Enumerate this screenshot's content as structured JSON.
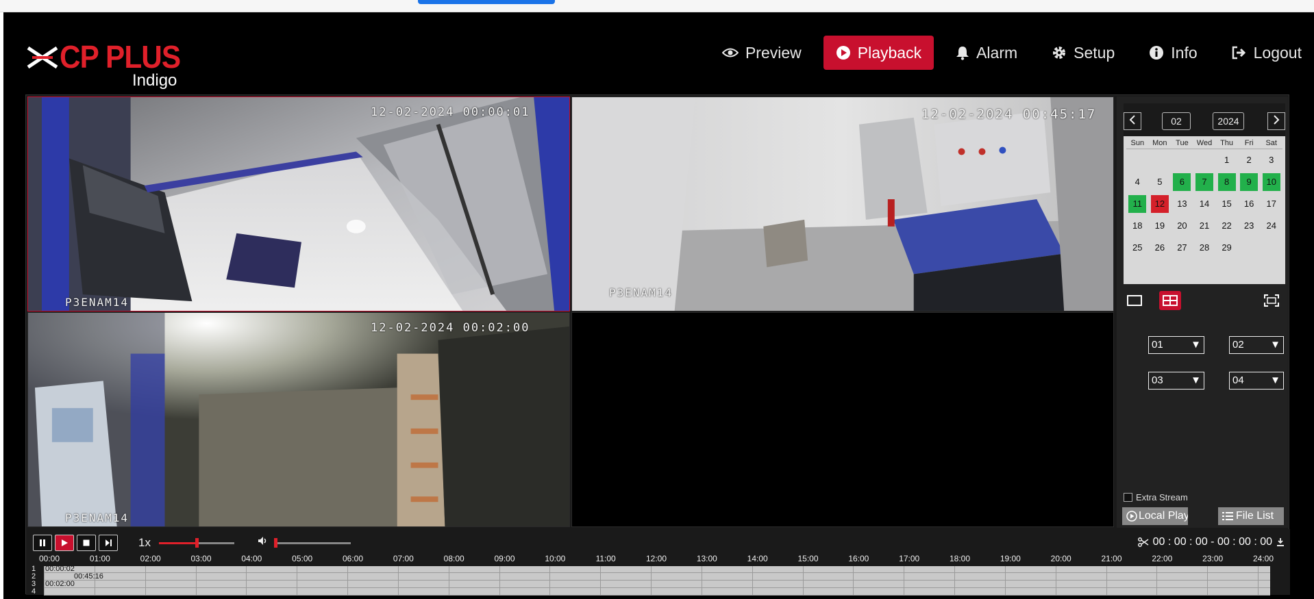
{
  "app": {
    "logo_brand": "CP PLUS",
    "logo_sub": "Indigo"
  },
  "nav": [
    {
      "label": "Preview",
      "icon": "eye-icon",
      "active": false
    },
    {
      "label": "Playback",
      "icon": "play-circle-icon",
      "active": true
    },
    {
      "label": "Alarm",
      "icon": "bell-icon",
      "active": false
    },
    {
      "label": "Setup",
      "icon": "gear-icon",
      "active": false
    },
    {
      "label": "Info",
      "icon": "info-icon",
      "active": false
    },
    {
      "label": "Logout",
      "icon": "logout-icon",
      "active": false
    }
  ],
  "channels": [
    {
      "timestamp": "12-02-2024 00:00:01",
      "name": "P3ENAM14"
    },
    {
      "timestamp": "12-02-2024 00:45:17",
      "name": "P3ENAM14"
    },
    {
      "timestamp": "12-02-2024 00:02:00",
      "name": "P3ENAM14"
    },
    {
      "timestamp": "",
      "name": ""
    }
  ],
  "calendar": {
    "month": "02",
    "year": "2024",
    "weekdays": [
      "Sun",
      "Mon",
      "Tue",
      "Wed",
      "Thu",
      "Fri",
      "Sat"
    ],
    "days": [
      "",
      "",
      "",
      "",
      "1",
      "2",
      "3",
      "4",
      "5",
      "6",
      "7",
      "8",
      "9",
      "10",
      "11",
      "12",
      "13",
      "14",
      "15",
      "16",
      "17",
      "18",
      "19",
      "20",
      "21",
      "22",
      "23",
      "24",
      "25",
      "26",
      "27",
      "28",
      "29",
      "",
      ""
    ],
    "recorded_days": [
      "6",
      "7",
      "8",
      "9",
      "10",
      "11"
    ],
    "selected_day": "12"
  },
  "channel_select": {
    "ch1": "01",
    "ch2": "02",
    "ch3": "03",
    "ch4": "04"
  },
  "side": {
    "extra_stream": "Extra Stream",
    "local_play": "Local Play",
    "file_list": "File List"
  },
  "controls": {
    "speed": "1x",
    "progress_fraction": 0.5,
    "volume_fraction": 0.0,
    "clip_range": "00 : 00 : 00 - 00 : 00 : 00"
  },
  "timeline": {
    "hours": [
      "00:00",
      "01:00",
      "02:00",
      "03:00",
      "04:00",
      "05:00",
      "06:00",
      "07:00",
      "08:00",
      "09:00",
      "10:00",
      "11:00",
      "12:00",
      "13:00",
      "14:00",
      "15:00",
      "16:00",
      "17:00",
      "18:00",
      "19:00",
      "20:00",
      "21:00",
      "22:00",
      "23:00",
      "24:00"
    ],
    "rows": [
      {
        "num": "1",
        "time": "00:00:02"
      },
      {
        "num": "2",
        "time": "00:45:16"
      },
      {
        "num": "3",
        "time": "00:02:00"
      },
      {
        "num": "4",
        "time": ""
      }
    ]
  },
  "colors": {
    "accent": "#c8102e",
    "recorded": "#22b04b",
    "selected": "#d4202a"
  }
}
